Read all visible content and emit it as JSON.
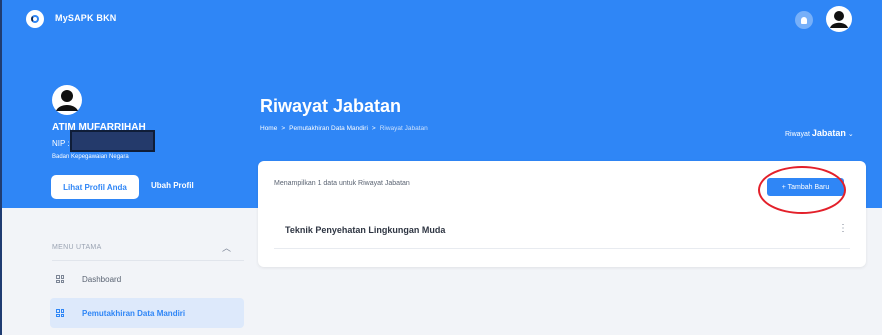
{
  "app": {
    "title": "MySAPK BKN"
  },
  "profile": {
    "name": "ATIM MUFARRIHAH",
    "nip_label": "NIP :",
    "org": "Badan Kepegawaian Negara",
    "view_button": "Lihat Profil Anda",
    "edit_button": "Ubah Profil"
  },
  "menu": {
    "header": "MENU UTAMA",
    "items": [
      {
        "label": "Dashboard",
        "icon": "grid-icon",
        "active": false
      },
      {
        "label": "Pemutakhiran Data Mandiri",
        "icon": "grid-icon",
        "active": true
      }
    ]
  },
  "page": {
    "title": "Riwayat Jabatan",
    "breadcrumb": [
      "Home",
      "Pemutakhiran Data Mandiri",
      "Riwayat Jabatan"
    ],
    "breadcrumb_sep": ">",
    "dropdown_prefix": "Riwayat",
    "dropdown_value": "Jabatan",
    "dropdown_caret": "⌄"
  },
  "card": {
    "info": "Menampilkan 1 data untuk Riwayat Jabatan",
    "add_button": "+ Tambah Baru",
    "rows": [
      {
        "title": "Teknik Penyehatan Lingkungan Muda"
      }
    ]
  },
  "colors": {
    "brand": "#2f86f6",
    "annotation": "#e3202a"
  }
}
